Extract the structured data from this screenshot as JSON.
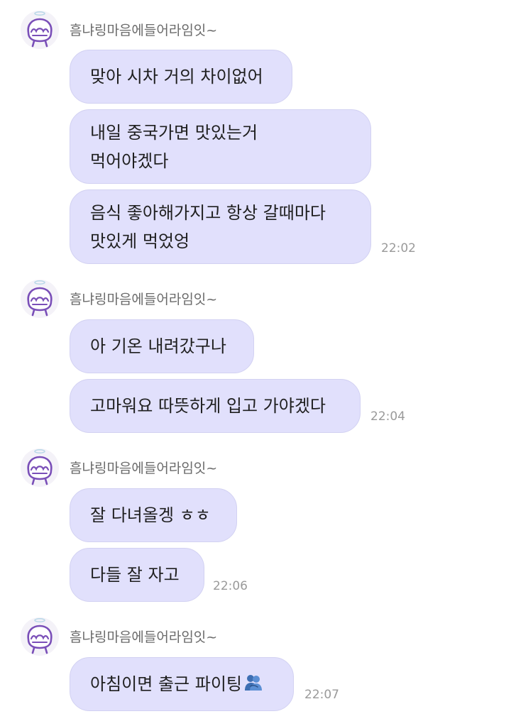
{
  "groups": [
    {
      "sender": "흠냐링마음에들어라임잇~",
      "messages": [
        {
          "lines": [
            "맞아 시차 거의 차이없어"
          ]
        },
        {
          "lines": [
            "내일 중국가면 맛있는거",
            "먹어야겠다"
          ]
        },
        {
          "lines": [
            "음식 좋아해가지고 항상 갈때마다",
            "맛있게 먹었엉"
          ]
        }
      ],
      "time": "22:02"
    },
    {
      "sender": "흠냐링마음에들어라임잇~",
      "messages": [
        {
          "lines": [
            "아 기온 내려갔구나"
          ]
        },
        {
          "lines": [
            "고마워요 따뜻하게 입고 가야겠다"
          ]
        }
      ],
      "time": "22:04"
    },
    {
      "sender": "흠냐링마음에들어라임잇~",
      "messages": [
        {
          "lines": [
            "잘 다녀올겡 ㅎㅎ"
          ]
        },
        {
          "lines": [
            "다들 잘 자고"
          ]
        }
      ],
      "time": "22:06"
    },
    {
      "sender": "흠냐링마음에들어라임잇~",
      "messages": [
        {
          "lines": [
            "아침이면 출근 파이팅"
          ],
          "emoji": "people-hugging-emoji"
        }
      ],
      "time": "22:07"
    }
  ],
  "colors": {
    "bubble": "#e1e0fc",
    "bubble_border": "#d2d1f2",
    "avatar_outline": "#7a4fb8",
    "text": "#1f1f1f",
    "sender": "#6b6b6b",
    "time": "#9a9a9a"
  }
}
